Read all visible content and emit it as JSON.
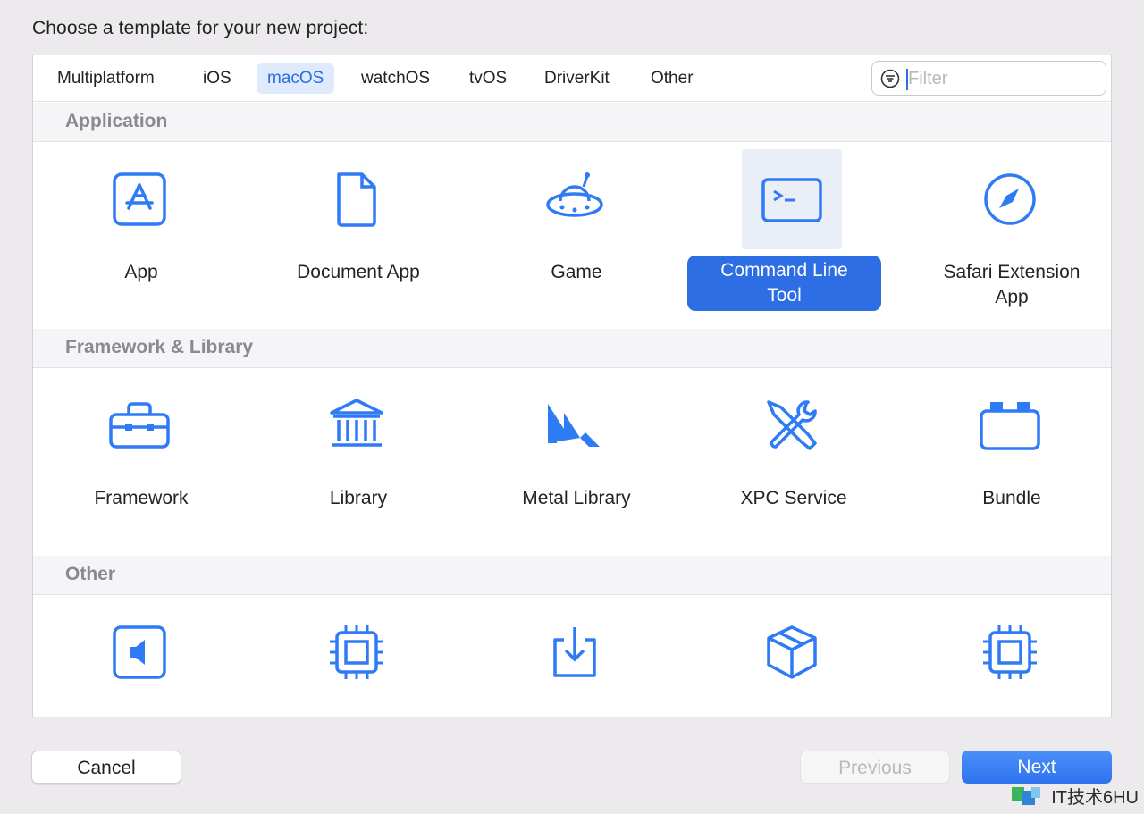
{
  "dialog": {
    "title": "Choose a template for your new project:"
  },
  "tabs": [
    {
      "label": "Multiplatform",
      "active": false
    },
    {
      "label": "iOS",
      "active": false
    },
    {
      "label": "macOS",
      "active": true
    },
    {
      "label": "watchOS",
      "active": false
    },
    {
      "label": "tvOS",
      "active": false
    },
    {
      "label": "DriverKit",
      "active": false
    },
    {
      "label": "Other",
      "active": false
    }
  ],
  "filter": {
    "placeholder": "Filter",
    "value": ""
  },
  "sections": [
    {
      "title": "Application",
      "items": [
        {
          "label": "App",
          "icon": "app-store-icon",
          "selected": false
        },
        {
          "label": "Document App",
          "icon": "document-icon",
          "selected": false
        },
        {
          "label": "Game",
          "icon": "ufo-game-icon",
          "selected": false
        },
        {
          "label": "Command Line\nTool",
          "icon": "terminal-icon",
          "selected": true
        },
        {
          "label": "Safari Extension\nApp",
          "icon": "compass-icon",
          "selected": false
        }
      ]
    },
    {
      "title": "Framework & Library",
      "items": [
        {
          "label": "Framework",
          "icon": "toolbox-icon",
          "selected": false
        },
        {
          "label": "Library",
          "icon": "library-building-icon",
          "selected": false
        },
        {
          "label": "Metal Library",
          "icon": "metal-icon",
          "selected": false
        },
        {
          "label": "XPC Service",
          "icon": "tools-icon",
          "selected": false
        },
        {
          "label": "Bundle",
          "icon": "bundle-icon",
          "selected": false
        }
      ]
    },
    {
      "title": "Other",
      "items": [
        {
          "label": "",
          "icon": "audio-unit-icon",
          "selected": false
        },
        {
          "label": "",
          "icon": "chip-icon",
          "selected": false
        },
        {
          "label": "",
          "icon": "download-tray-icon",
          "selected": false
        },
        {
          "label": "",
          "icon": "package-box-icon",
          "selected": false
        },
        {
          "label": "",
          "icon": "chip-icon",
          "selected": false
        }
      ]
    }
  ],
  "buttons": {
    "cancel": "Cancel",
    "previous": "Previous",
    "next": "Next"
  },
  "watermark": {
    "text": "IT技术6HU"
  },
  "colors": {
    "accent": "#2D6EE4",
    "icon": "#2F7BF5",
    "tab_active_bg": "#DFEAFD",
    "section_text": "#8A8A8E"
  }
}
